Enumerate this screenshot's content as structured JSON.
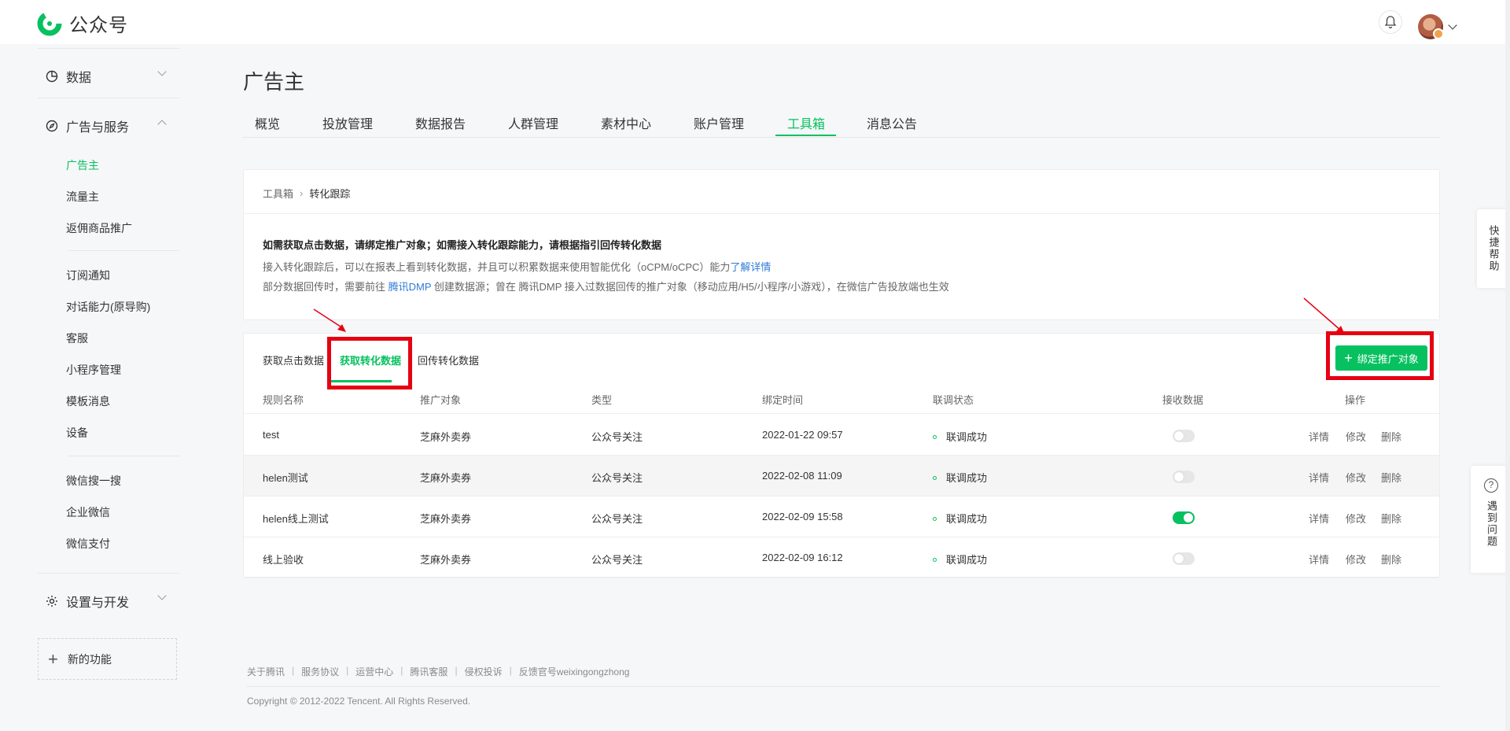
{
  "app": {
    "name": "公众号"
  },
  "sidebar": {
    "groups": [
      {
        "label": "数据",
        "icon": "pie-chart-icon"
      },
      {
        "label": "广告与服务",
        "icon": "compass-icon"
      },
      {
        "label": "设置与开发",
        "icon": "gear-icon"
      }
    ],
    "items": [
      "广告主",
      "流量主",
      "返佣商品推广",
      "订阅通知",
      "对话能力(原导购)",
      "客服",
      "小程序管理",
      "模板消息",
      "设备",
      "微信搜一搜",
      "企业微信",
      "微信支付"
    ],
    "new_function": "新的功能"
  },
  "page": {
    "title": "广告主"
  },
  "main_tabs": [
    "概览",
    "投放管理",
    "数据报告",
    "人群管理",
    "素材中心",
    "账户管理",
    "工具箱",
    "消息公告"
  ],
  "breadcrumb": {
    "root": "工具箱",
    "current": "转化跟踪"
  },
  "notice": {
    "title": "如需获取点击数据，请绑定推广对象；如需接入转化跟踪能力，请根据指引回传转化数据",
    "line1": "接入转化跟踪后，可以在报表上看到转化数据，并且可以积累数据来使用智能优化（oCPM/oCPC）能力",
    "line1_link": "了解详情",
    "line2_a": "部分数据回传时，需要前往",
    "line2_link": "腾讯DMP",
    "line2_b": "创建数据源；曾在 腾讯DMP 接入过数据回传的推广对象（移动应用/H5/小程序/小游戏），在微信广告投放端也生效"
  },
  "sub_tabs": [
    "获取点击数据",
    "获取转化数据",
    "回传转化数据"
  ],
  "bind_button": "绑定推广对象",
  "table": {
    "headers": [
      "规则名称",
      "推广对象",
      "类型",
      "绑定时间",
      "联调状态",
      "接收数据",
      "操作"
    ],
    "rows": [
      {
        "name": "test",
        "target": "芝麻外卖券",
        "type": "公众号关注",
        "time": "2022-01-22 09:57",
        "status": "联调成功",
        "receive": false
      },
      {
        "name": "helen测试",
        "target": "芝麻外卖券",
        "type": "公众号关注",
        "time": "2022-02-08 11:09",
        "status": "联调成功",
        "receive": false
      },
      {
        "name": "helen线上测试",
        "target": "芝麻外卖券",
        "type": "公众号关注",
        "time": "2022-02-09 15:58",
        "status": "联调成功",
        "receive": true
      },
      {
        "name": "线上验收",
        "target": "芝麻外卖券",
        "type": "公众号关注",
        "time": "2022-02-09 16:12",
        "status": "联调成功",
        "receive": false
      }
    ],
    "actions": [
      "详情",
      "修改",
      "删除"
    ]
  },
  "footer": {
    "links": [
      "关于腾讯",
      "服务协议",
      "运营中心",
      "腾讯客服",
      "侵权投诉",
      "反馈官号weixingongzhong"
    ],
    "copyright": "Copyright © 2012-2022 Tencent. All Rights Reserved."
  },
  "float": {
    "quick_help": "快捷帮助",
    "problem": "遇到问题"
  },
  "colors": {
    "accent": "#07c160",
    "link": "#2e7bd6",
    "annotation": "#e60012"
  }
}
